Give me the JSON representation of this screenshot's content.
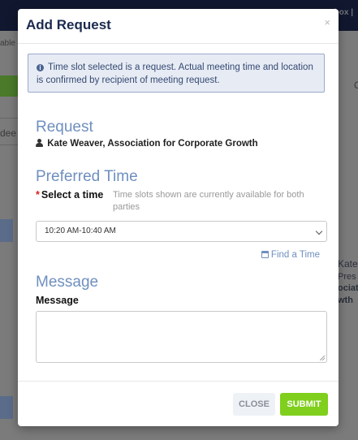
{
  "background": {
    "top_right_text": "box |",
    "left_fragment_1": "able",
    "left_fragment_2": "dee",
    "left_fragment_3": "C",
    "side_name": "Kate",
    "side_sub_1": "Pres",
    "side_sub_2": "ociat",
    "side_sub_3": "wth"
  },
  "modal": {
    "title": "Add Request",
    "close_symbol": "×",
    "info_icon": "i",
    "info_text": "Time slot selected is a request. Actual meeting time and location is confirmed by recipient of meeting request.",
    "request_heading": "Request",
    "person": "Kate Weaver, Association for Corporate Growth",
    "preferred_heading": "Preferred Time",
    "required_mark": "*",
    "select_label": "Select a time",
    "select_help": "Time slots shown are currently available for both parties",
    "selected_time": "10:20 AM-10:40 AM",
    "find_time_label": "Find a Time",
    "message_heading": "Message",
    "message_label": "Message",
    "message_value": "",
    "close_button": "CLOSE",
    "submit_button": "SUBMIT"
  },
  "icons": {
    "info": "info-circle-icon",
    "person": "user-icon",
    "calendar": "calendar-icon",
    "close": "close-icon",
    "dropdown": "chevron-down-icon"
  },
  "colors": {
    "heading": "#6f8fbf",
    "title": "#1b2a4e",
    "submit": "#7fcf1c",
    "info_bg": "#e7ebf4",
    "required": "#d81f1f"
  }
}
